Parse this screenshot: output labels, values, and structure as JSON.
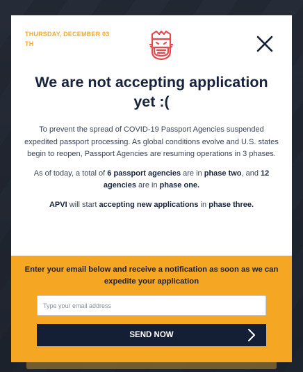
{
  "modal": {
    "date_line1": "THURSDAY, DECEMBER 03",
    "date_line2": "TH",
    "mascot_icon": "masked-face-icon",
    "close_icon": "close-icon",
    "title": "We are not accepting application yet :(",
    "intro": "To prevent the spread of COVID-19 Passport Agencies suspended expedited passport processing. As global conditions evolve and U.S. states begin to reopen, Passport Agencies are resuming operations in 3 phases.",
    "status": {
      "p1": "As of today, a total of ",
      "phase_two_count": "6 passport agencies",
      "p2": " are in ",
      "phase_two": "phase two",
      "p3": ", and ",
      "phase_one_count": "12 agencies",
      "p4": " are in ",
      "phase_one": "phase one."
    },
    "plan": {
      "org": "APVI",
      "p1": " will start ",
      "action": "accepting new applications",
      "p2": " in ",
      "phase": "phase three."
    }
  },
  "cta": {
    "text": "Enter your email below and receive a notification as soon as we can expedite your application",
    "email_placeholder": "Type your email address",
    "email_value": "",
    "send_label": "SEND NOW",
    "send_icon": "chevron-right-icon"
  },
  "colors": {
    "accent": "#f5a623",
    "navy": "#141f36",
    "mascot": "#e8474c"
  }
}
